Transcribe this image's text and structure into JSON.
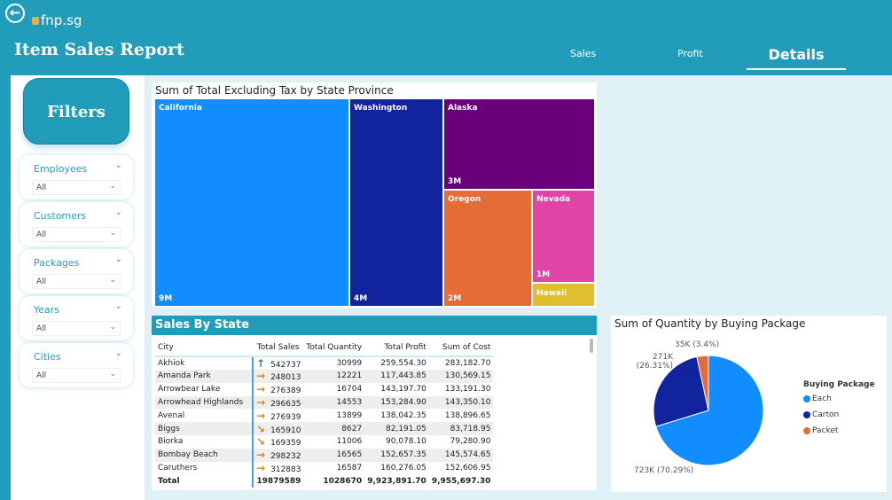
{
  "header": {
    "title": "Item Sales Report",
    "logo": "fnp.sg",
    "tabs": [
      {
        "label": "Sales"
      },
      {
        "label": "Profit"
      },
      {
        "label": "Details"
      }
    ]
  },
  "sidebar": {
    "filters_label": "Filters",
    "slicers": [
      {
        "label": "Employees",
        "value": "All"
      },
      {
        "label": "Customers",
        "value": "All"
      },
      {
        "label": "Packages",
        "value": "All"
      },
      {
        "label": "Years",
        "value": "All"
      },
      {
        "label": "Cities",
        "value": "All"
      }
    ]
  },
  "treemap": {
    "title": "Sum of Total Excluding Tax by State Province",
    "tiles": [
      {
        "name": "California",
        "value": "9M",
        "color": "#118dff"
      },
      {
        "name": "Washington",
        "value": "4M",
        "color": "#12239e"
      },
      {
        "name": "Alaska",
        "value": "3M",
        "color": "#6b007b"
      },
      {
        "name": "Oregon",
        "value": "2M",
        "color": "#e66c37"
      },
      {
        "name": "Nevada",
        "value": "1M",
        "color": "#e044a7"
      },
      {
        "name": "Hawaii",
        "value": "",
        "color": "#dfbf2f"
      }
    ]
  },
  "table": {
    "title": "Sales By State",
    "columns": [
      "City",
      "Total Sales",
      "Total Quantity",
      "Total Profit",
      "Sum of Cost"
    ],
    "rows": [
      {
        "city": "Akhiok",
        "trend": "up",
        "sales": "542737",
        "qty": "30999",
        "profit": "259,554.30",
        "cost": "283,182.70"
      },
      {
        "city": "Amanda Park",
        "trend": "right",
        "sales": "248013",
        "qty": "12221",
        "profit": "117,443.85",
        "cost": "130,569.15"
      },
      {
        "city": "Arrowbear Lake",
        "trend": "right",
        "sales": "276389",
        "qty": "16704",
        "profit": "143,197.70",
        "cost": "133,191.30"
      },
      {
        "city": "Arrowhead Highlands",
        "trend": "right",
        "sales": "296635",
        "qty": "14553",
        "profit": "153,284.90",
        "cost": "143,350.10"
      },
      {
        "city": "Avenal",
        "trend": "right",
        "sales": "276939",
        "qty": "13899",
        "profit": "138,042.35",
        "cost": "138,896.65"
      },
      {
        "city": "Biggs",
        "trend": "down-right",
        "sales": "165910",
        "qty": "8627",
        "profit": "82,191.05",
        "cost": "83,718.95"
      },
      {
        "city": "Biorka",
        "trend": "down-right",
        "sales": "169359",
        "qty": "11006",
        "profit": "90,078.10",
        "cost": "79,280.90"
      },
      {
        "city": "Bombay Beach",
        "trend": "right",
        "sales": "298232",
        "qty": "16565",
        "profit": "152,657.35",
        "cost": "145,574.65"
      },
      {
        "city": "Caruthers",
        "trend": "right",
        "sales": "312883",
        "qty": "16587",
        "profit": "160,276.05",
        "cost": "152,606.95"
      }
    ],
    "total": {
      "label": "Total",
      "sales": "19879589",
      "qty": "1028670",
      "profit": "9,923,891.70",
      "cost": "9,955,697.30"
    }
  },
  "chart_data": {
    "type": "pie",
    "title": "Sum of Quantity by Buying Package",
    "legend_title": "Buying Package",
    "legend_position": "right",
    "slices": [
      {
        "name": "Each",
        "value": 723000,
        "percent": 70.29,
        "label": "723K (70.29%)",
        "color": "#118dff"
      },
      {
        "name": "Carton",
        "value": 271000,
        "percent": 26.31,
        "label": "271K (26.31%)",
        "color": "#12239e"
      },
      {
        "name": "Packet",
        "value": 35000,
        "percent": 3.4,
        "label": "35K (3.4%)",
        "color": "#e66c37"
      }
    ]
  }
}
